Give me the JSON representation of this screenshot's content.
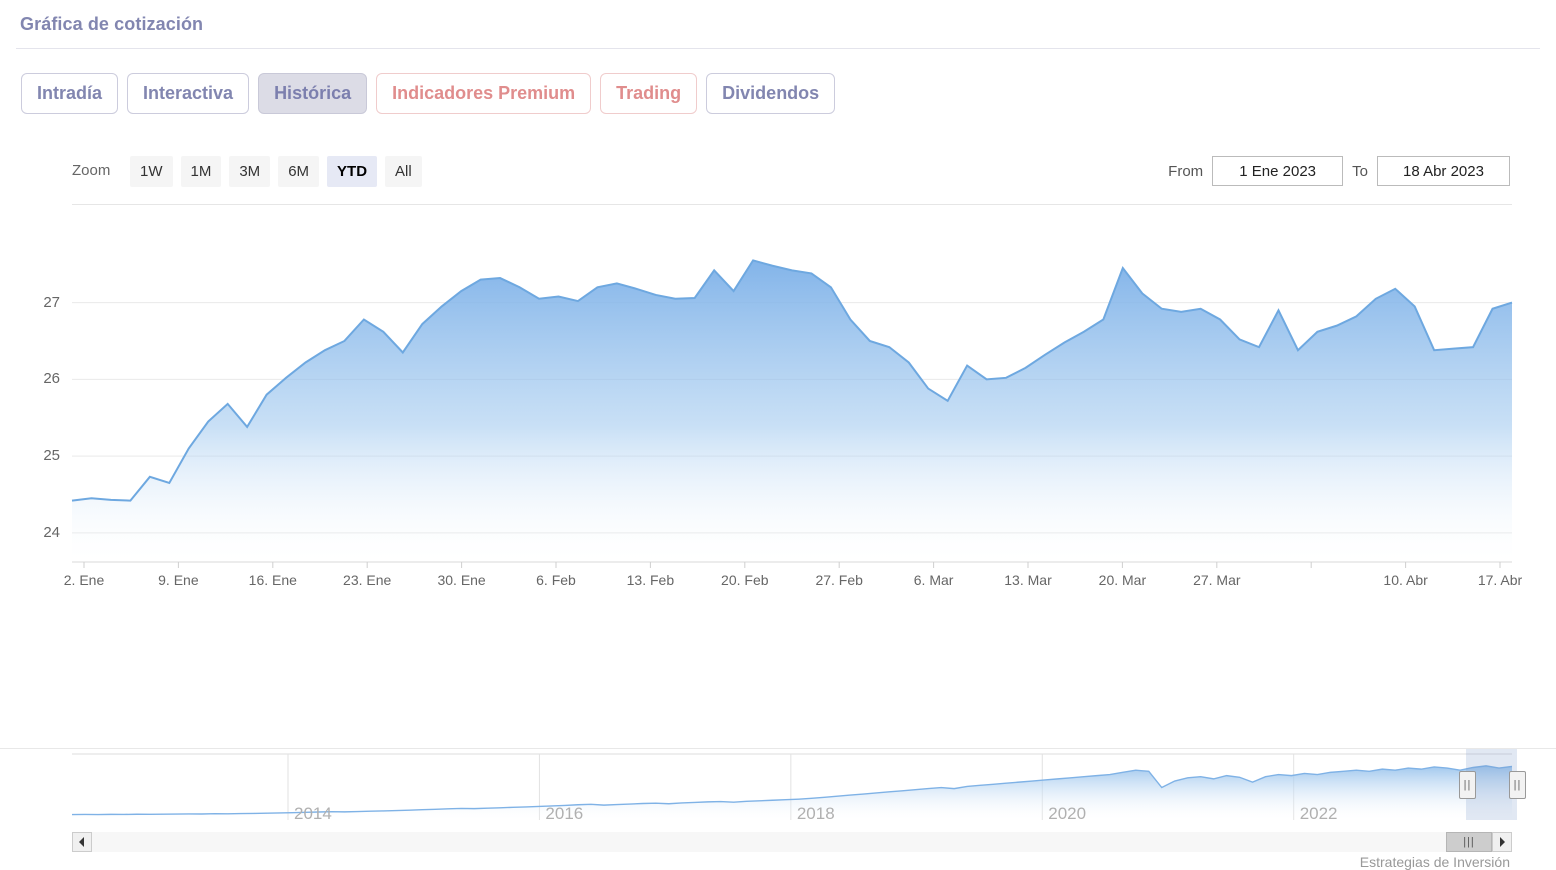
{
  "header": {
    "title": "Gráfica de cotización"
  },
  "tabs": [
    {
      "label": "Intradía",
      "state": "normal"
    },
    {
      "label": "Interactiva",
      "state": "normal"
    },
    {
      "label": "Histórica",
      "state": "active"
    },
    {
      "label": "Indicadores Premium",
      "state": "premium"
    },
    {
      "label": "Trading",
      "state": "premium"
    },
    {
      "label": "Dividendos",
      "state": "normal"
    }
  ],
  "range": {
    "zoom_label": "Zoom",
    "buttons": [
      {
        "label": "1W",
        "active": false
      },
      {
        "label": "1M",
        "active": false
      },
      {
        "label": "3M",
        "active": false
      },
      {
        "label": "6M",
        "active": false
      },
      {
        "label": "YTD",
        "active": true
      },
      {
        "label": "All",
        "active": false
      }
    ],
    "from_label": "From",
    "from_value": "1 Ene 2023",
    "to_label": "To",
    "to_value": "18 Abr 2023"
  },
  "navigator": {
    "years": [
      "2014",
      "2016",
      "2018",
      "2020",
      "2022"
    ],
    "left_handle_icon": "resize-handle-icon",
    "right_handle_icon": "resize-handle-icon",
    "scroll_left_icon": "chevron-left-icon",
    "scroll_right_icon": "chevron-right-icon",
    "thumb_grip": "|||"
  },
  "credit": "Estrategias de Inversión",
  "colors": {
    "accent": "#7cb0e8",
    "line": "#6ea8e0",
    "title": "#8286b0",
    "premium": "#e08d8d",
    "tab_active_bg": "#dcdce6"
  },
  "chart_data": {
    "type": "area",
    "title": "Gráfica de cotización",
    "xlabel": "",
    "ylabel": "",
    "ylim": [
      23.62,
      27.92
    ],
    "yticks": [
      24,
      25,
      26,
      27
    ],
    "grid": true,
    "legend": "none",
    "xtick_labels": [
      "2. Ene",
      "9. Ene",
      "16. Ene",
      "23. Ene",
      "30. Ene",
      "6. Feb",
      "13. Feb",
      "20. Feb",
      "27. Feb",
      "6. Mar",
      "13. Mar",
      "20. Mar",
      "27. Mar",
      "",
      "10. Abr",
      "17. Abr"
    ],
    "x": [
      "2023-01-02",
      "2023-01-03",
      "2023-01-04",
      "2023-01-05",
      "2023-01-06",
      "2023-01-09",
      "2023-01-10",
      "2023-01-11",
      "2023-01-12",
      "2023-01-13",
      "2023-01-16",
      "2023-01-17",
      "2023-01-18",
      "2023-01-19",
      "2023-01-20",
      "2023-01-23",
      "2023-01-24",
      "2023-01-25",
      "2023-01-26",
      "2023-01-27",
      "2023-01-30",
      "2023-01-31",
      "2023-02-01",
      "2023-02-02",
      "2023-02-03",
      "2023-02-06",
      "2023-02-07",
      "2023-02-08",
      "2023-02-09",
      "2023-02-10",
      "2023-02-13",
      "2023-02-14",
      "2023-02-15",
      "2023-02-16",
      "2023-02-17",
      "2023-02-20",
      "2023-02-21",
      "2023-02-22",
      "2023-02-23",
      "2023-02-24",
      "2023-02-27",
      "2023-02-28",
      "2023-03-01",
      "2023-03-02",
      "2023-03-03",
      "2023-03-06",
      "2023-03-07",
      "2023-03-08",
      "2023-03-09",
      "2023-03-10",
      "2023-03-13",
      "2023-03-14",
      "2023-03-15",
      "2023-03-16",
      "2023-03-17",
      "2023-03-20",
      "2023-03-21",
      "2023-03-22",
      "2023-03-23",
      "2023-03-24",
      "2023-03-27",
      "2023-03-28",
      "2023-03-29",
      "2023-03-30",
      "2023-03-31",
      "2023-04-03",
      "2023-04-04",
      "2023-04-05",
      "2023-04-06",
      "2023-04-11",
      "2023-04-12",
      "2023-04-13",
      "2023-04-14",
      "2023-04-17",
      "2023-04-18"
    ],
    "values": [
      24.42,
      24.45,
      24.43,
      24.42,
      24.73,
      24.65,
      25.1,
      25.45,
      25.68,
      25.38,
      25.8,
      26.02,
      26.22,
      26.38,
      26.5,
      26.78,
      26.62,
      26.35,
      26.72,
      26.95,
      27.15,
      27.3,
      27.32,
      27.2,
      27.05,
      27.08,
      27.02,
      27.2,
      27.25,
      27.18,
      27.1,
      27.05,
      27.06,
      27.42,
      27.15,
      27.55,
      27.48,
      27.42,
      27.38,
      27.2,
      26.78,
      26.5,
      26.42,
      26.22,
      25.88,
      25.72,
      26.18,
      26.0,
      26.02,
      26.15,
      26.32,
      26.48,
      26.62,
      26.78,
      27.45,
      27.12,
      26.92,
      26.88,
      26.92,
      26.78,
      26.52,
      26.42,
      26.9,
      26.38,
      26.62,
      26.7,
      26.82,
      27.05,
      27.18,
      26.95,
      26.38,
      26.4,
      26.42,
      26.92,
      27.0
    ]
  },
  "nav_chart_data": {
    "type": "area",
    "values": [
      10,
      10.2,
      10.1,
      10.4,
      10.3,
      10.6,
      10.5,
      10.8,
      11.0,
      11.2,
      11.1,
      11.6,
      11.4,
      11.9,
      12.2,
      12.6,
      13.0,
      13.5,
      14.2,
      14.8,
      15.4,
      15.0,
      15.6,
      16.2,
      16.8,
      17.4,
      18.2,
      19.0,
      19.8,
      20.6,
      21.4,
      21.0,
      21.8,
      22.6,
      23.4,
      24.2,
      25.0,
      26.0,
      27.0,
      28.2,
      29.0,
      27.5,
      28.5,
      29.5,
      30.5,
      31.0,
      30.0,
      31.5,
      32.5,
      33.5,
      34.0,
      33.0,
      34.5,
      35.5,
      36.5,
      37.5,
      38.5,
      40.0,
      42.0,
      44.0,
      46.0,
      48.0,
      50.0,
      52.0,
      54.0,
      56.0,
      58.0,
      60.0,
      58.0,
      62.0,
      64.0,
      66.0,
      68.0,
      70.0,
      72.0,
      74.0,
      76.0,
      78.0,
      80.0,
      82.0,
      84.0,
      88.0,
      92.0,
      90.0,
      60.0,
      72.0,
      78.0,
      80.0,
      76.0,
      82.0,
      79.0,
      70.0,
      80.0,
      84.0,
      82.0,
      86.0,
      84.0,
      88.0,
      90.0,
      92.0,
      90.0,
      94.0,
      92.0,
      96.0,
      94.0,
      98.0,
      96.0,
      92.0,
      97.0,
      100.0,
      96.0,
      99.0
    ]
  }
}
